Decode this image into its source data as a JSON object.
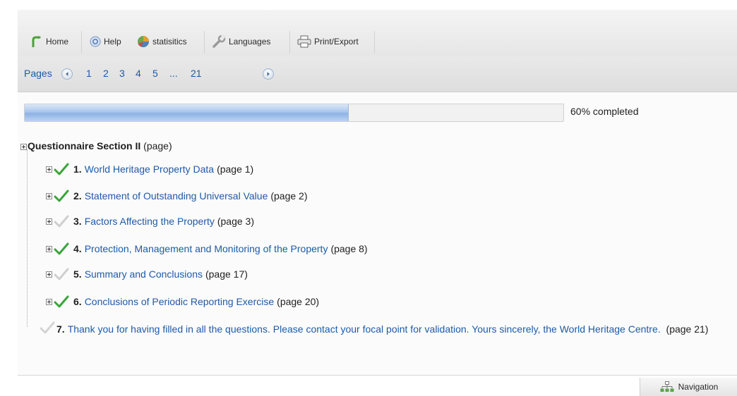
{
  "toolbar": {
    "home": "Home",
    "help": "Help",
    "statistics": "statisitics",
    "languages": "Languages",
    "print": "Print/Export"
  },
  "pagination": {
    "label": "Pages",
    "pages": [
      "1",
      "2",
      "3",
      "4",
      "5",
      "...",
      "21"
    ]
  },
  "progress": {
    "percent": 60,
    "text": "60% completed"
  },
  "tree": {
    "root_title": "Questionnaire Section II",
    "root_suffix": "(page)",
    "items": [
      {
        "num": "1.",
        "title": "World Heritage Property Data",
        "suffix": "(page 1)",
        "status": "complete"
      },
      {
        "num": "2.",
        "title": "Statement of Outstanding Universal Value",
        "suffix": "(page 2)",
        "status": "complete"
      },
      {
        "num": "3.",
        "title": "Factors Affecting the Property",
        "suffix": "(page 3)",
        "status": "incomplete"
      },
      {
        "num": "4.",
        "title": "Protection, Management and Monitoring of the Property",
        "suffix": "(page 8)",
        "status": "complete"
      },
      {
        "num": "5.",
        "title": "Summary and Conclusions",
        "suffix": "(page 17)",
        "status": "incomplete"
      },
      {
        "num": "6.",
        "title": "Conclusions of Periodic Reporting Exercise",
        "suffix": "(page 20)",
        "status": "complete"
      }
    ],
    "final": {
      "num": "7.",
      "title": "Thank you for having filled in all the questions. Please contact your focal point for validation. Yours sincerely, the World Heritage Centre.",
      "suffix": "(page 21)",
      "status": "incomplete"
    }
  },
  "navigation": "Navigation",
  "colors": {
    "link": "#1e5aa8",
    "check_complete": "#3aa53a",
    "check_incomplete": "#cfcfcf"
  }
}
